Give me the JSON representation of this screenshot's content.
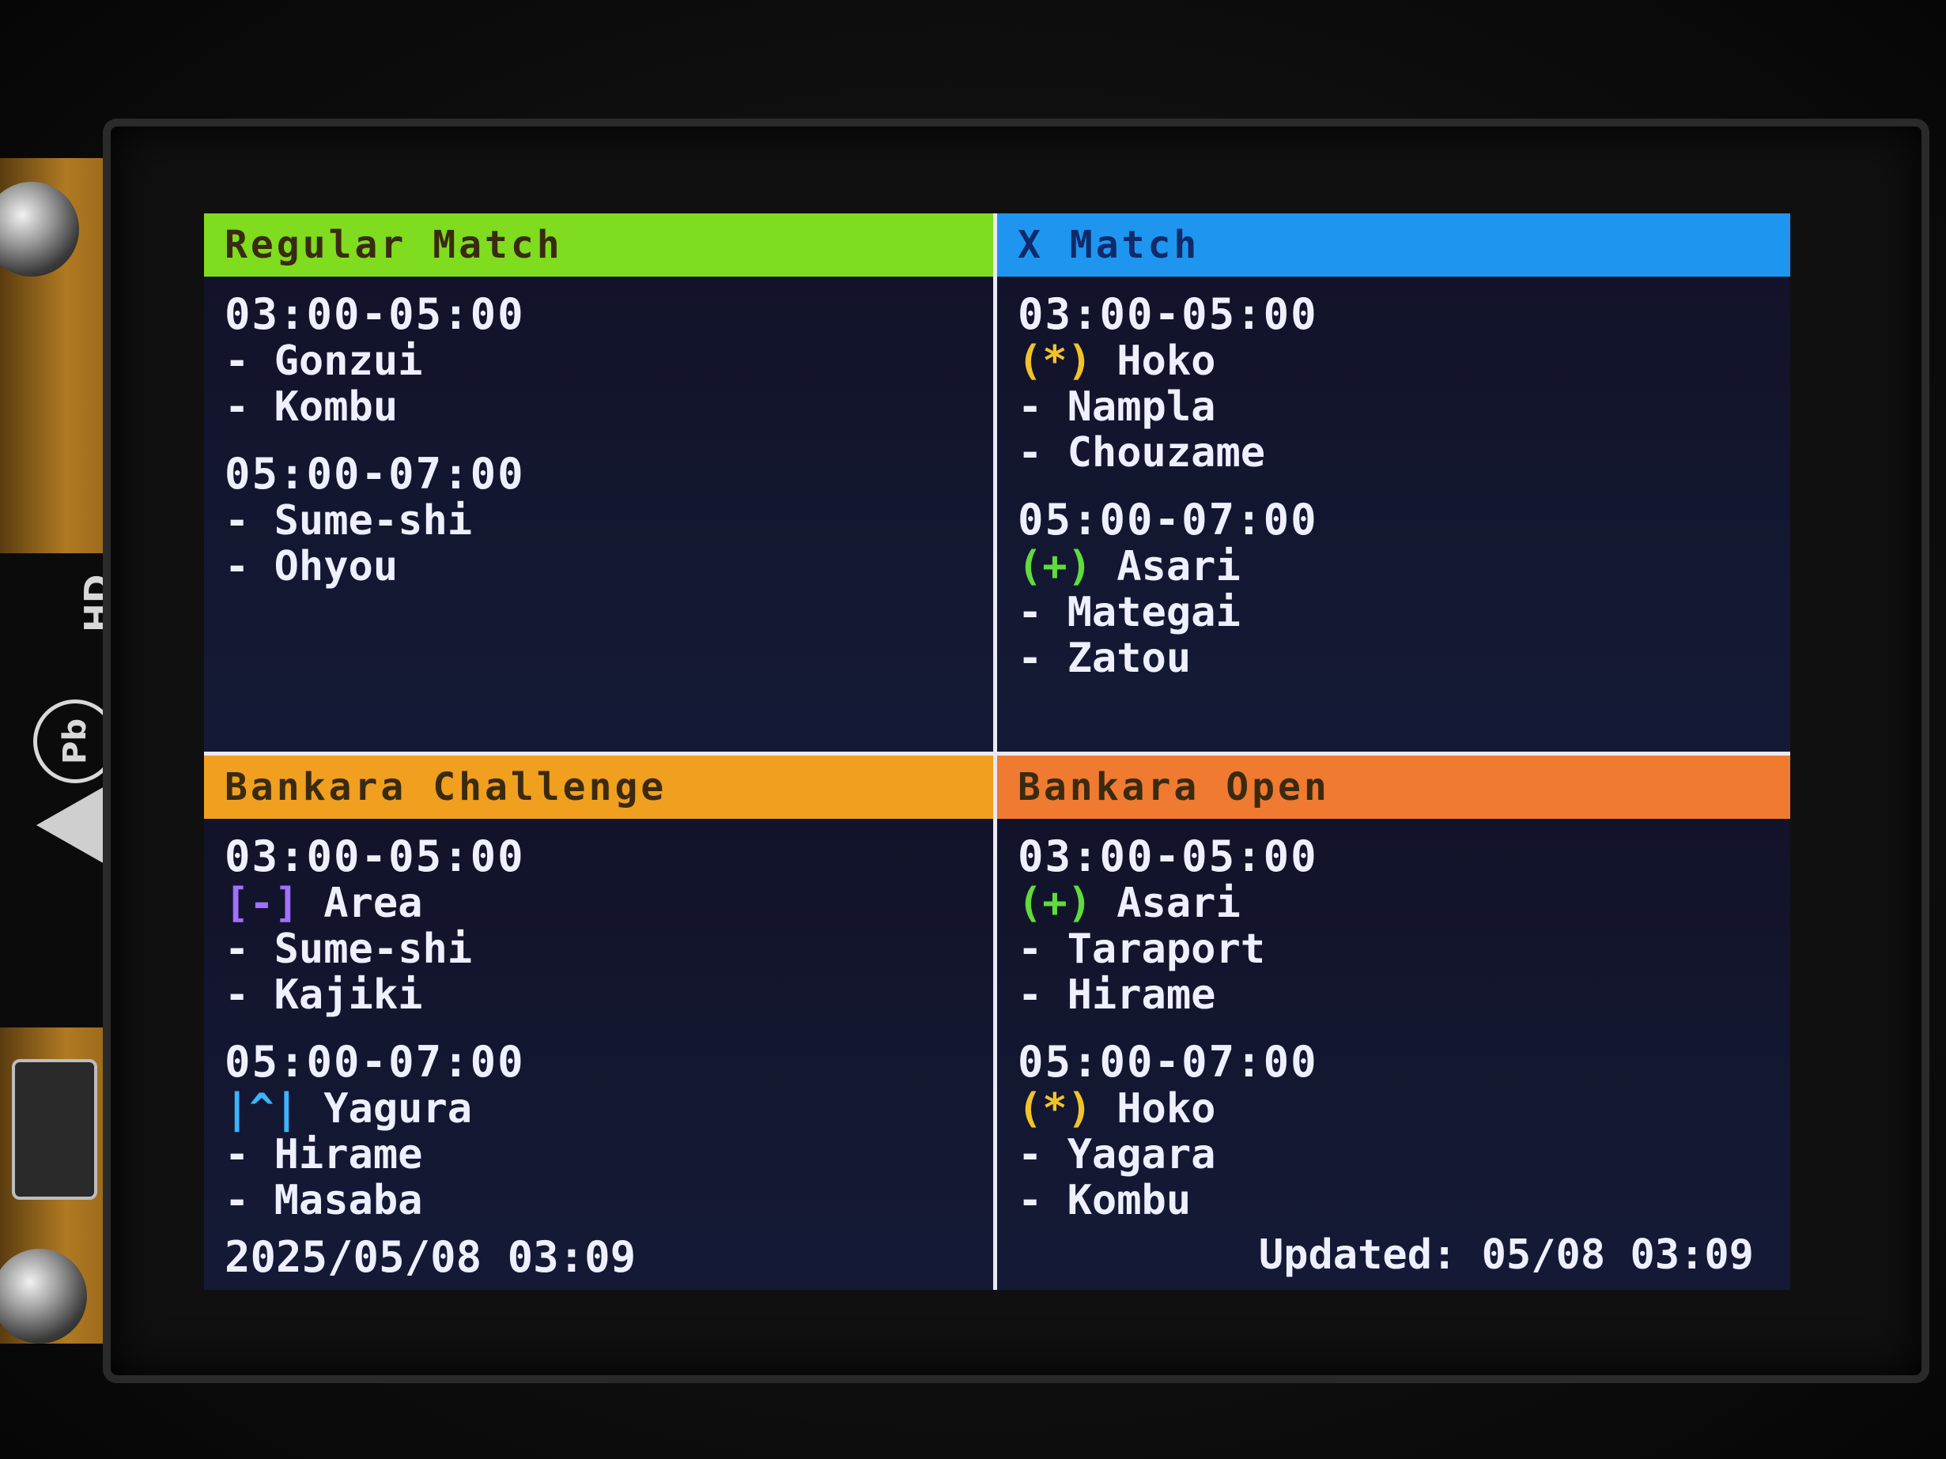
{
  "colors": {
    "regular": "#7fdc1e",
    "x": "#1e96f0",
    "challenge": "#f0a01e",
    "open": "#f07a30",
    "header_text": "#3a2a10",
    "x_header_text": "#0e2a6a",
    "rule_hoko": "#f2c22a",
    "rule_asari": "#5fdc3c",
    "rule_area": "#a070ff",
    "rule_yagura": "#3cb4ff"
  },
  "panels": {
    "regular": {
      "title": "Regular Match",
      "slots": [
        {
          "time": "03:00-05:00",
          "lines": [
            "- Gonzui",
            "- Kombu"
          ]
        },
        {
          "time": "05:00-07:00",
          "lines": [
            "- Sume-shi",
            "- Ohyou"
          ]
        }
      ]
    },
    "x": {
      "title": "X Match",
      "slots": [
        {
          "time": "03:00-05:00",
          "rule_icon": "(*)",
          "rule": "Hoko",
          "lines": [
            "- Nampla",
            "- Chouzame"
          ]
        },
        {
          "time": "05:00-07:00",
          "rule_icon": "(+)",
          "rule": "Asari",
          "lines": [
            "- Mategai",
            "- Zatou"
          ]
        }
      ]
    },
    "challenge": {
      "title": "Bankara Challenge",
      "slots": [
        {
          "time": "03:00-05:00",
          "rule_icon": "[-]",
          "rule": "Area",
          "lines": [
            "- Sume-shi",
            "- Kajiki"
          ]
        },
        {
          "time": "05:00-07:00",
          "rule_icon": "|^|",
          "rule": "Yagura",
          "lines": [
            "- Hirame",
            "- Masaba"
          ]
        }
      ],
      "footer": "2025/05/08 03:09"
    },
    "open": {
      "title": "Bankara Open",
      "slots": [
        {
          "time": "03:00-05:00",
          "rule_icon": "(+)",
          "rule": "Asari",
          "lines": [
            "- Taraport",
            "- Hirame"
          ]
        },
        {
          "time": "05:00-07:00",
          "rule_icon": "(*)",
          "rule": "Hoko",
          "lines": [
            "- Yagara",
            "- Kombu"
          ]
        }
      ],
      "footer": "Updated: 05/08 03:09"
    }
  },
  "device": {
    "sd_label": "HD",
    "pb_logo": "Pb"
  }
}
